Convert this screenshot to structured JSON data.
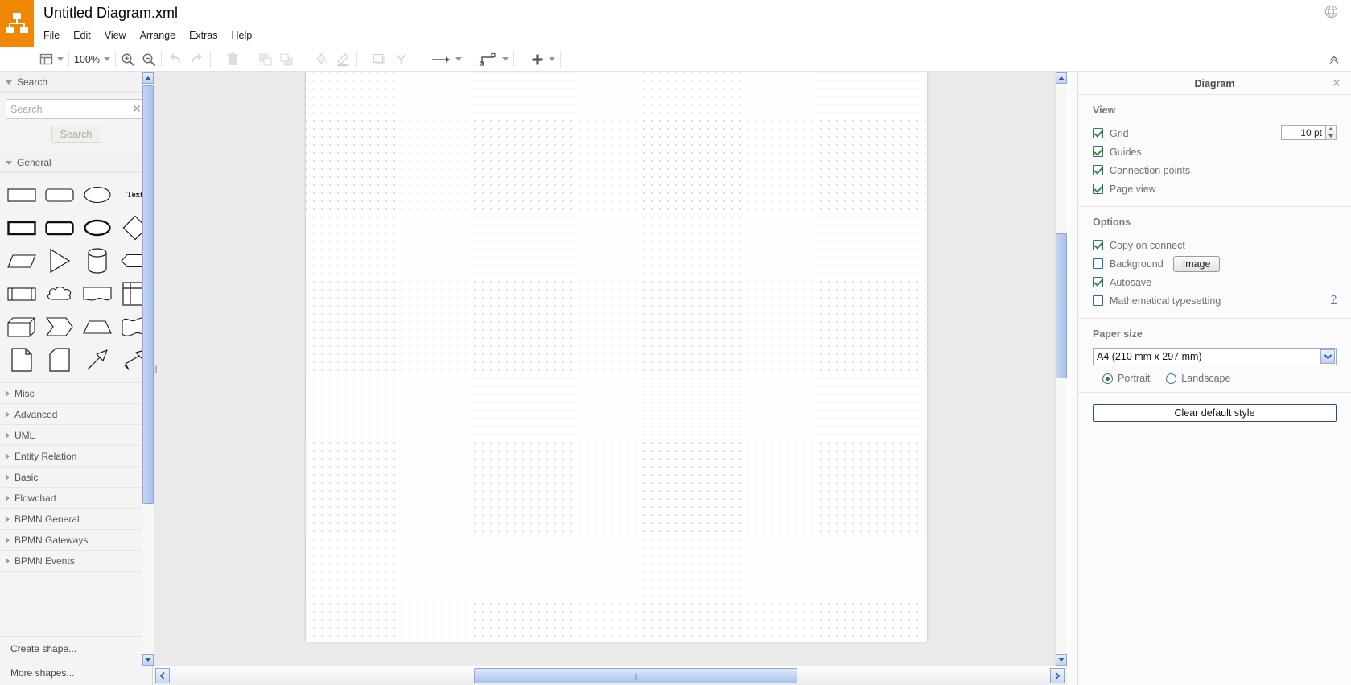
{
  "header": {
    "title": "Untitled Diagram.xml",
    "logo_icon": "drawio-logo-icon",
    "globe_icon": "language-globe-icon",
    "menus": [
      {
        "label": "File",
        "name": "menu-file"
      },
      {
        "label": "Edit",
        "name": "menu-edit"
      },
      {
        "label": "View",
        "name": "menu-view"
      },
      {
        "label": "Arrange",
        "name": "menu-arrange"
      },
      {
        "label": "Extras",
        "name": "menu-extras"
      },
      {
        "label": "Help",
        "name": "menu-help"
      }
    ]
  },
  "toolbar": {
    "view_icon": "view-layout-icon",
    "zoom_label": "100%",
    "zoom_in_icon": "zoom-in-icon",
    "zoom_out_icon": "zoom-out-icon",
    "undo_icon": "undo-icon",
    "redo_icon": "redo-icon",
    "delete_icon": "trash-icon",
    "to_front_icon": "bring-to-front-icon",
    "to_back_icon": "send-to-back-icon",
    "fill_icon": "fill-color-icon",
    "line_icon": "line-color-icon",
    "shadow_icon": "shadow-icon",
    "waypoint_icon": "waypoints-icon",
    "connection_icon": "connection-arrow-icon",
    "edge_style_icon": "edge-style-icon",
    "insert_icon": "insert-plus-icon",
    "collapse_icon": "collapse-toolbar-icon"
  },
  "sidebar": {
    "search_section": {
      "title": "Search",
      "input_value": "",
      "placeholder": "Search",
      "clear_icon": "clear-search-icon",
      "button_label": "Search"
    },
    "general_section": {
      "title": "General",
      "shapes": [
        [
          {
            "name": "shape-rectangle",
            "icon": "rectangle-icon"
          },
          {
            "name": "shape-rounded-rectangle",
            "icon": "rounded-rectangle-icon"
          },
          {
            "name": "shape-ellipse",
            "icon": "ellipse-icon"
          },
          {
            "name": "shape-text",
            "icon": "text-icon",
            "label": "Text"
          }
        ],
        [
          {
            "name": "shape-square-bold",
            "icon": "bold-rectangle-icon"
          },
          {
            "name": "shape-rounded-bold",
            "icon": "bold-rounded-rectangle-icon"
          },
          {
            "name": "shape-circle-bold",
            "icon": "bold-ellipse-icon"
          },
          {
            "name": "shape-diamond",
            "icon": "diamond-icon"
          }
        ],
        [
          {
            "name": "shape-parallelogram",
            "icon": "parallelogram-icon"
          },
          {
            "name": "shape-triangle",
            "icon": "triangle-icon"
          },
          {
            "name": "shape-cylinder",
            "icon": "cylinder-icon"
          },
          {
            "name": "shape-hexagon",
            "icon": "hexagon-icon"
          }
        ],
        [
          {
            "name": "shape-process",
            "icon": "process-icon"
          },
          {
            "name": "shape-cloud",
            "icon": "cloud-icon"
          },
          {
            "name": "shape-document",
            "icon": "document-icon"
          },
          {
            "name": "shape-internal-storage",
            "icon": "internal-storage-icon"
          }
        ],
        [
          {
            "name": "shape-cube",
            "icon": "cube-icon"
          },
          {
            "name": "shape-step",
            "icon": "step-icon"
          },
          {
            "name": "shape-trapezoid",
            "icon": "trapezoid-icon"
          },
          {
            "name": "shape-tape",
            "icon": "tape-icon"
          }
        ],
        [
          {
            "name": "shape-note",
            "icon": "note-icon"
          },
          {
            "name": "shape-card",
            "icon": "card-icon"
          },
          {
            "name": "shape-arrow",
            "icon": "single-arrow-icon"
          },
          {
            "name": "shape-double-arrow",
            "icon": "double-arrow-icon"
          }
        ]
      ]
    },
    "libraries": [
      {
        "label": "Misc",
        "name": "library-misc"
      },
      {
        "label": "Advanced",
        "name": "library-advanced"
      },
      {
        "label": "UML",
        "name": "library-uml"
      },
      {
        "label": "Entity Relation",
        "name": "library-entity-relation"
      },
      {
        "label": "Basic",
        "name": "library-basic"
      },
      {
        "label": "Flowchart",
        "name": "library-flowchart"
      },
      {
        "label": "BPMN General",
        "name": "library-bpmn-general"
      },
      {
        "label": "BPMN Gateways",
        "name": "library-bpmn-gateways"
      },
      {
        "label": "BPMN Events",
        "name": "library-bpmn-events"
      }
    ],
    "footer": [
      {
        "label": "Create shape...",
        "name": "create-shape-button"
      },
      {
        "label": "More shapes...",
        "name": "more-shapes-button"
      }
    ]
  },
  "format_panel": {
    "title": "Diagram",
    "close_icon": "close-icon",
    "view": {
      "heading": "View",
      "grid": {
        "label": "Grid",
        "checked": true,
        "size_value": "10 pt"
      },
      "guides": {
        "label": "Guides",
        "checked": true
      },
      "connection_points": {
        "label": "Connection points",
        "checked": true
      },
      "page_view": {
        "label": "Page view",
        "checked": true
      }
    },
    "options": {
      "heading": "Options",
      "copy_on_connect": {
        "label": "Copy on connect",
        "checked": true
      },
      "background": {
        "label": "Background",
        "checked": false,
        "image_button": "Image"
      },
      "autosave": {
        "label": "Autosave",
        "checked": true
      },
      "math_typesetting": {
        "label": "Mathematical typesetting",
        "checked": false,
        "help": "?"
      }
    },
    "paper": {
      "heading": "Paper size",
      "selected": "A4 (210 mm x 297 mm)",
      "portrait": {
        "label": "Portrait",
        "selected": true
      },
      "landscape": {
        "label": "Landscape",
        "selected": false
      }
    },
    "clear_style_label": "Clear default style"
  },
  "colors": {
    "brand_orange": "#f08705",
    "scrollbar_blue": "#a9c0ea",
    "check_green": "#3a8a34",
    "grid_dot": "#d7d7d7"
  }
}
